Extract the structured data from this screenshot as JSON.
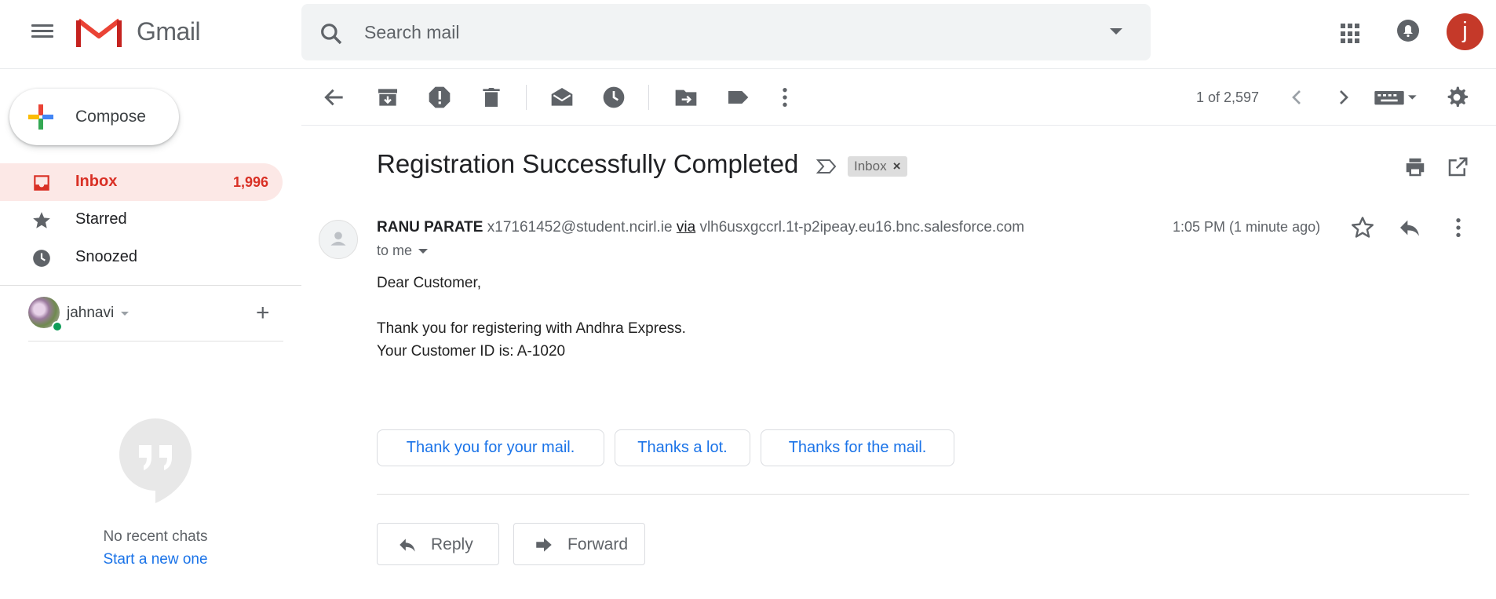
{
  "header": {
    "app_name": "Gmail",
    "search_placeholder": "Search mail",
    "avatar_initial": "j"
  },
  "sidebar": {
    "compose_label": "Compose",
    "items": [
      {
        "label": "Inbox",
        "count": "1,996",
        "icon": "inbox-icon",
        "active": true
      },
      {
        "label": "Starred",
        "count": "",
        "icon": "star-icon",
        "active": false
      },
      {
        "label": "Snoozed",
        "count": "",
        "icon": "clock-icon",
        "active": false
      }
    ],
    "hangouts_user": "jahnavi",
    "no_chats": "No recent chats",
    "start_new": "Start a new one"
  },
  "toolbar": {
    "pager": "1 of 2,597",
    "icons": [
      "back-arrow-icon",
      "archive-icon",
      "report-spam-icon",
      "delete-icon",
      "mark-unread-icon",
      "snooze-icon",
      "move-to-icon",
      "label-icon",
      "more-vert-icon",
      "newer-icon",
      "older-icon",
      "keyboard-icon",
      "settings-icon"
    ]
  },
  "message": {
    "subject": "Registration Successfully Completed",
    "label_chip": "Inbox",
    "sender_name": "RANU PARATE",
    "sender_email": "x17161452@student.ncirl.ie",
    "via_label": "via",
    "via_domain": "vlh6usxgccrl.1t-p2ipeay.eu16.bnc.salesforce.com",
    "to": "to me",
    "time": "1:05 PM (1 minute ago)",
    "body": {
      "greeting": "Dear Customer,",
      "line1": "Thank you for registering with Andhra Express.",
      "line2": "Your Customer ID is: A-1020"
    },
    "smart_replies": [
      "Thank you for your mail.",
      "Thanks a lot.",
      "Thanks for the mail."
    ],
    "reply_label": "Reply",
    "forward_label": "Forward"
  },
  "colors": {
    "accent_red": "#d93025",
    "link_blue": "#1a73e8",
    "active_bg": "#fce8e6",
    "avatar_bg": "#c53929"
  }
}
